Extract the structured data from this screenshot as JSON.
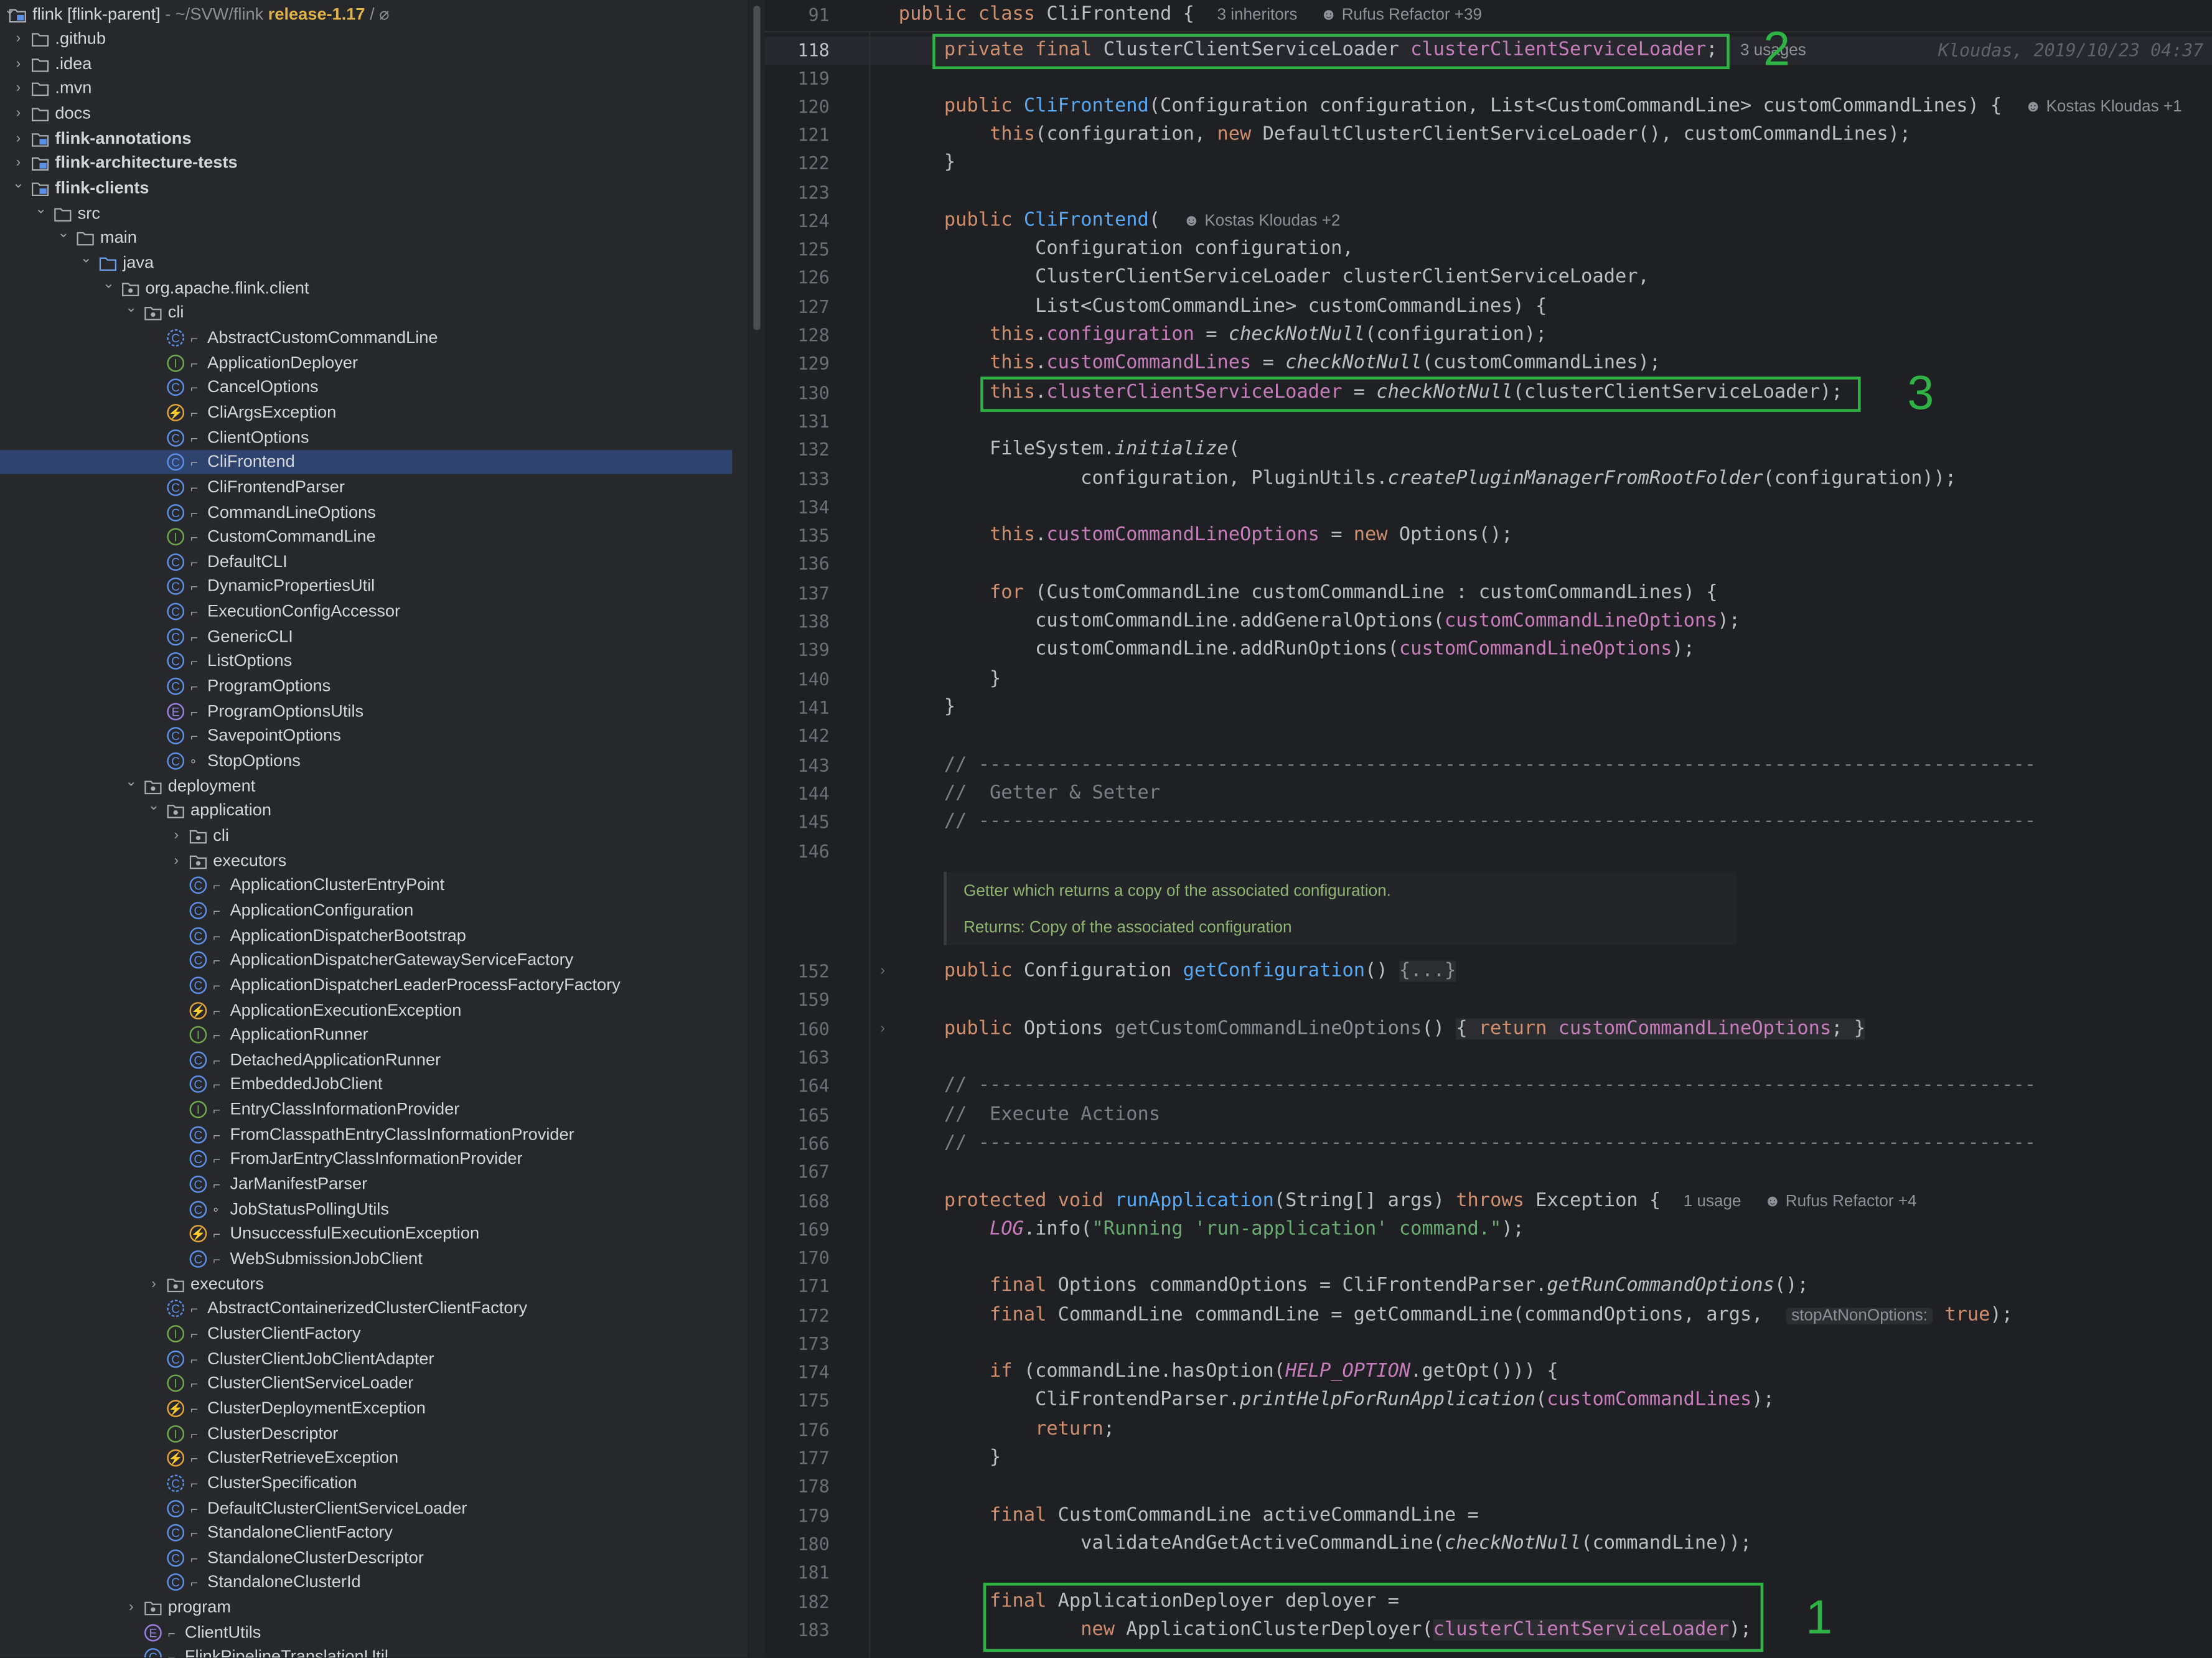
{
  "project": {
    "root_name": "flink [flink-parent]",
    "root_path": "~/SVW/flink",
    "branch": "release-1.17",
    "nodes": [
      {
        "label": "flink [flink-parent]",
        "depth": 0,
        "kind": "root",
        "chev": "down"
      },
      {
        "label": ".github",
        "depth": 0,
        "kind": "folder",
        "chev": "right"
      },
      {
        "label": ".idea",
        "depth": 0,
        "kind": "folder",
        "chev": "right"
      },
      {
        "label": ".mvn",
        "depth": 0,
        "kind": "folder",
        "chev": "right"
      },
      {
        "label": "docs",
        "depth": 0,
        "kind": "folder",
        "chev": "right"
      },
      {
        "label": "flink-annotations",
        "depth": 0,
        "kind": "module",
        "chev": "right",
        "bold": true
      },
      {
        "label": "flink-architecture-tests",
        "depth": 0,
        "kind": "module",
        "chev": "right",
        "bold": true
      },
      {
        "label": "flink-clients",
        "depth": 0,
        "kind": "module",
        "chev": "down",
        "bold": true
      },
      {
        "label": "src",
        "depth": 1,
        "kind": "folder",
        "chev": "down"
      },
      {
        "label": "main",
        "depth": 2,
        "kind": "folder",
        "chev": "down"
      },
      {
        "label": "java",
        "depth": 3,
        "kind": "srcfolder",
        "chev": "down"
      },
      {
        "label": "org.apache.flink.client",
        "depth": 4,
        "kind": "package",
        "chev": "down"
      },
      {
        "label": "cli",
        "depth": 5,
        "kind": "package",
        "chev": "down"
      },
      {
        "label": "AbstractCustomCommandLine",
        "depth": 6,
        "kind": "abstract",
        "lock": true
      },
      {
        "label": "ApplicationDeployer",
        "depth": 6,
        "kind": "interface",
        "lock": true
      },
      {
        "label": "CancelOptions",
        "depth": 6,
        "kind": "class",
        "lock": true
      },
      {
        "label": "CliArgsException",
        "depth": 6,
        "kind": "exception",
        "lock": true
      },
      {
        "label": "ClientOptions",
        "depth": 6,
        "kind": "class",
        "lock": true
      },
      {
        "label": "CliFrontend",
        "depth": 6,
        "kind": "class",
        "lock": true,
        "selected": true
      },
      {
        "label": "CliFrontendParser",
        "depth": 6,
        "kind": "class",
        "lock": true
      },
      {
        "label": "CommandLineOptions",
        "depth": 6,
        "kind": "class",
        "lock": true
      },
      {
        "label": "CustomCommandLine",
        "depth": 6,
        "kind": "interface",
        "lock": true
      },
      {
        "label": "DefaultCLI",
        "depth": 6,
        "kind": "class",
        "lock": true
      },
      {
        "label": "DynamicPropertiesUtil",
        "depth": 6,
        "kind": "class",
        "lock": true
      },
      {
        "label": "ExecutionConfigAccessor",
        "depth": 6,
        "kind": "class",
        "lock": true
      },
      {
        "label": "GenericCLI",
        "depth": 6,
        "kind": "class",
        "lock": true
      },
      {
        "label": "ListOptions",
        "depth": 6,
        "kind": "class",
        "lock": true
      },
      {
        "label": "ProgramOptions",
        "depth": 6,
        "kind": "class",
        "lock": true
      },
      {
        "label": "ProgramOptionsUtils",
        "depth": 6,
        "kind": "enum",
        "lock": true
      },
      {
        "label": "SavepointOptions",
        "depth": 6,
        "kind": "class",
        "lock": true
      },
      {
        "label": "StopOptions",
        "depth": 6,
        "kind": "class",
        "pkg": true
      },
      {
        "label": "deployment",
        "depth": 5,
        "kind": "package",
        "chev": "down"
      },
      {
        "label": "application",
        "depth": 6,
        "kind": "package",
        "chev": "down"
      },
      {
        "label": "cli",
        "depth": 7,
        "kind": "package",
        "chev": "right"
      },
      {
        "label": "executors",
        "depth": 7,
        "kind": "package",
        "chev": "right"
      },
      {
        "label": "ApplicationClusterEntryPoint",
        "depth": 7,
        "kind": "class",
        "lock": true
      },
      {
        "label": "ApplicationConfiguration",
        "depth": 7,
        "kind": "class",
        "lock": true
      },
      {
        "label": "ApplicationDispatcherBootstrap",
        "depth": 7,
        "kind": "class",
        "lock": true
      },
      {
        "label": "ApplicationDispatcherGatewayServiceFactory",
        "depth": 7,
        "kind": "class",
        "lock": true
      },
      {
        "label": "ApplicationDispatcherLeaderProcessFactoryFactory",
        "depth": 7,
        "kind": "class",
        "lock": true
      },
      {
        "label": "ApplicationExecutionException",
        "depth": 7,
        "kind": "exception",
        "lock": true
      },
      {
        "label": "ApplicationRunner",
        "depth": 7,
        "kind": "interface",
        "lock": true
      },
      {
        "label": "DetachedApplicationRunner",
        "depth": 7,
        "kind": "class",
        "lock": true
      },
      {
        "label": "EmbeddedJobClient",
        "depth": 7,
        "kind": "class",
        "lock": true
      },
      {
        "label": "EntryClassInformationProvider",
        "depth": 7,
        "kind": "interface",
        "lock": true
      },
      {
        "label": "FromClasspathEntryClassInformationProvider",
        "depth": 7,
        "kind": "class",
        "lock": true
      },
      {
        "label": "FromJarEntryClassInformationProvider",
        "depth": 7,
        "kind": "class",
        "lock": true
      },
      {
        "label": "JarManifestParser",
        "depth": 7,
        "kind": "class",
        "lock": true
      },
      {
        "label": "JobStatusPollingUtils",
        "depth": 7,
        "kind": "class",
        "pkg": true
      },
      {
        "label": "UnsuccessfulExecutionException",
        "depth": 7,
        "kind": "exception",
        "lock": true
      },
      {
        "label": "WebSubmissionJobClient",
        "depth": 7,
        "kind": "class",
        "lock": true
      },
      {
        "label": "executors",
        "depth": 6,
        "kind": "package",
        "chev": "right"
      },
      {
        "label": "AbstractContainerizedClusterClientFactory",
        "depth": 6,
        "kind": "abstract",
        "lock": true
      },
      {
        "label": "ClusterClientFactory",
        "depth": 6,
        "kind": "interface",
        "lock": true
      },
      {
        "label": "ClusterClientJobClientAdapter",
        "depth": 6,
        "kind": "class",
        "lock": true
      },
      {
        "label": "ClusterClientServiceLoader",
        "depth": 6,
        "kind": "interface",
        "lock": true
      },
      {
        "label": "ClusterDeploymentException",
        "depth": 6,
        "kind": "exception",
        "lock": true
      },
      {
        "label": "ClusterDescriptor",
        "depth": 6,
        "kind": "interface",
        "lock": true
      },
      {
        "label": "ClusterRetrieveException",
        "depth": 6,
        "kind": "exception",
        "lock": true
      },
      {
        "label": "ClusterSpecification",
        "depth": 6,
        "kind": "abstract",
        "lock": true
      },
      {
        "label": "DefaultClusterClientServiceLoader",
        "depth": 6,
        "kind": "class",
        "lock": true
      },
      {
        "label": "StandaloneClientFactory",
        "depth": 6,
        "kind": "class",
        "lock": true
      },
      {
        "label": "StandaloneClusterDescriptor",
        "depth": 6,
        "kind": "class",
        "lock": true
      },
      {
        "label": "StandaloneClusterId",
        "depth": 6,
        "kind": "class",
        "lock": true
      },
      {
        "label": "program",
        "depth": 5,
        "kind": "package",
        "chev": "right"
      },
      {
        "label": "ClientUtils",
        "depth": 5,
        "kind": "enum",
        "lock": true
      },
      {
        "label": "FlinkPipelineTranslationUtil",
        "depth": 5,
        "kind": "class",
        "lock": true
      }
    ]
  },
  "editor": {
    "header_line": "91",
    "header_inherit": "3 inheritors",
    "header_author": "Rufus Refactor +39",
    "blame": "Kloudas, 2019/10/23 04:37",
    "usages_118": "3 usages",
    "author_120": "Kostas Kloudas +1",
    "author_124": "Kostas Kloudas +2",
    "usage_168": "1 usage",
    "author_168": "Rufus Refactor +4",
    "param_hint": "stopAtNonOptions:",
    "doc_line1": "Getter which returns a copy of the associated configuration.",
    "doc_line2": "Returns: Copy of the associated configuration",
    "line_numbers": [
      "118",
      "119",
      "120",
      "121",
      "122",
      "123",
      "124",
      "125",
      "126",
      "127",
      "128",
      "129",
      "130",
      "131",
      "132",
      "133",
      "134",
      "135",
      "136",
      "137",
      "138",
      "139",
      "140",
      "141",
      "142",
      "143",
      "144",
      "145",
      "146",
      "152",
      "159",
      "160",
      "163",
      "164",
      "165",
      "166",
      "167",
      "168",
      "169",
      "170",
      "171",
      "172",
      "173",
      "174",
      "175",
      "176",
      "177",
      "178",
      "179",
      "180",
      "181",
      "182",
      "183"
    ],
    "annotations": [
      "2",
      "3",
      "1"
    ]
  }
}
